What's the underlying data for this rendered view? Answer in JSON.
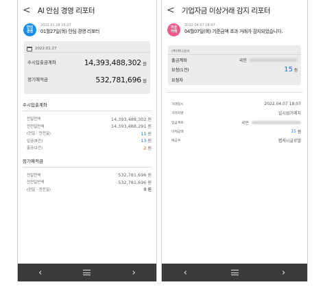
{
  "left": {
    "title": "AI 안심 경영 리포터",
    "badge": "안심\n경영",
    "msg_time": "2022.01.28 15:27",
    "msg_title": "01월27일(목) 안심 경영 리포터",
    "card": {
      "date": "2022.01.27",
      "rows": [
        {
          "label": "수시입출금계좌",
          "amount": "14,393,488,302",
          "unit": "원"
        },
        {
          "label": "정기예적금",
          "amount": "532,781,696",
          "unit": "원"
        }
      ]
    },
    "sections": [
      {
        "title": "수시입출계좌",
        "rows": [
          {
            "label": "전일잔액",
            "value": "14,393,488,302",
            "unit": "원",
            "color": "#666666"
          },
          {
            "label": "전전일잔액",
            "value": "14,393,488,291",
            "unit": "원",
            "color": "#666666"
          },
          {
            "label": "(전일 - 전전일)",
            "value": "11",
            "unit": "원",
            "color": "#1a73e8"
          },
          {
            "label": "입금(8건)",
            "value": "13",
            "unit": "원",
            "color": "#1a73e8"
          },
          {
            "label": "출금(2건)",
            "value": "2",
            "unit": "원",
            "color": "#e53935"
          }
        ]
      },
      {
        "title": "정기예적금",
        "rows": [
          {
            "label": "전일잔액",
            "value": "532,781,696",
            "unit": "원",
            "color": "#666666"
          },
          {
            "label": "전전일잔액",
            "value": "532,781,696",
            "unit": "원",
            "color": "#666666"
          },
          {
            "label": "(전일 - 전전일)",
            "value": "0",
            "unit": "원",
            "color": "#222222"
          }
        ]
      }
    ]
  },
  "right": {
    "title": "기업자금 이상거래 감지 리포터",
    "badge": "이상\n거래",
    "msg_time": "2022.04.07 18:07",
    "msg_title": "04월07일(목) 기준금액 초과 거래가 감지되었습니다.",
    "card": {
      "company": "(주)하나상사",
      "account_label": "출금계좌",
      "account_value": "국민",
      "request_label": "요청(1건)",
      "request_amount": "15",
      "request_unit": "원",
      "requester_label": "요청자"
    },
    "details": [
      {
        "label": "거래일시",
        "value": "2022.04.07 18:07"
      },
      {
        "label": "거래처명",
        "value": "일시성거래처"
      },
      {
        "label": "입금계좌",
        "value": "국민"
      },
      {
        "label": "이체금액",
        "value": "15",
        "unit": "원"
      },
      {
        "label": "예금주",
        "value": "펩케시글로벌"
      }
    ]
  },
  "nav": {
    "back": "‹",
    "forward": "›"
  },
  "colors": {
    "blue": "#1a8ee8",
    "pink": "#f05a8a",
    "navbar": "#3a3a3a"
  }
}
